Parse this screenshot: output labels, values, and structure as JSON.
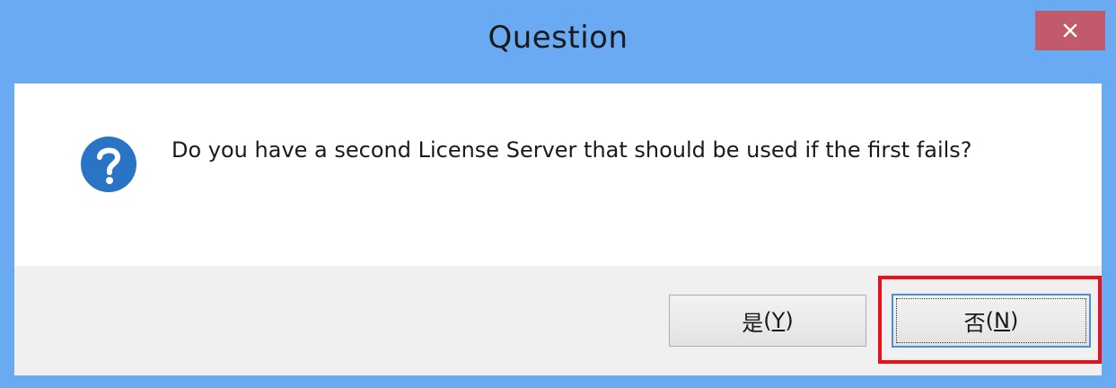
{
  "window": {
    "title": "Question",
    "close_icon": "close-icon"
  },
  "message": {
    "icon": "question-icon",
    "text": "Do you have a second License Server that should be used if the first fails?"
  },
  "buttons": {
    "yes_label": "是",
    "yes_mnemonic": "Y",
    "no_label": "否",
    "no_mnemonic": "N"
  },
  "colors": {
    "titlebar": "#6aaaf2",
    "close_button": "#c15b6b",
    "highlight": "#e8101a",
    "icon": "#2a74c6"
  }
}
